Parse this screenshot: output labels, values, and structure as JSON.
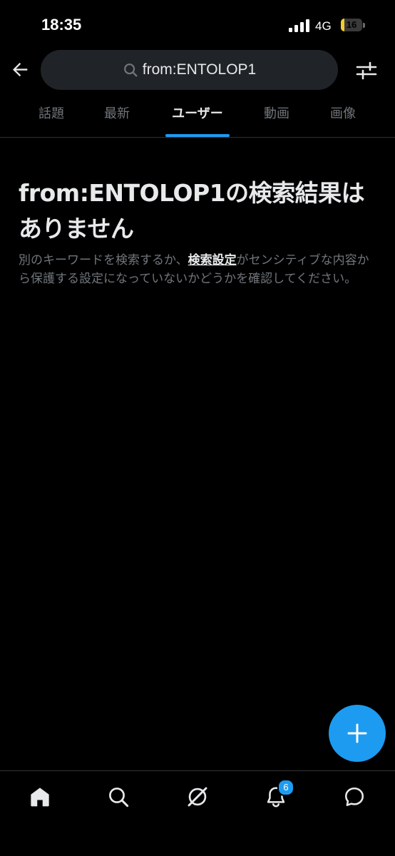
{
  "status_bar": {
    "time": "18:35",
    "network": "4G",
    "battery_level": "16",
    "battery_fraction": 0.16,
    "battery_color": "#f2cd2e"
  },
  "header": {
    "back_icon": "arrow-left-icon",
    "search_icon": "search-icon",
    "search_query": "from:ENTOLOP1",
    "filter_icon": "sliders-icon"
  },
  "tabs": [
    {
      "label": "話題",
      "active": false
    },
    {
      "label": "最新",
      "active": false
    },
    {
      "label": "ユーザー",
      "active": true
    },
    {
      "label": "動画",
      "active": false
    },
    {
      "label": "画像",
      "active": false
    }
  ],
  "empty_state": {
    "title": "from:ENTOLOP1の検索結果はありません",
    "description_before": "別のキーワードを検索するか、",
    "description_link": "検索設定",
    "description_after": "がセンシティブな内容から保護する設定になっていないかどうかを確認してください。"
  },
  "fab": {
    "icon": "plus-icon"
  },
  "bottom_nav": {
    "items": [
      {
        "name": "home",
        "icon": "home-icon"
      },
      {
        "name": "search",
        "icon": "search-icon"
      },
      {
        "name": "grok",
        "icon": "grok-icon"
      },
      {
        "name": "notifications",
        "icon": "bell-icon",
        "badge": "6"
      },
      {
        "name": "messages",
        "icon": "chat-bubble-icon"
      }
    ]
  },
  "colors": {
    "background": "#000000",
    "accent": "#1d9bf0",
    "text_primary": "#e7e9ea",
    "text_secondary": "#71767b",
    "search_bg": "#202327"
  }
}
